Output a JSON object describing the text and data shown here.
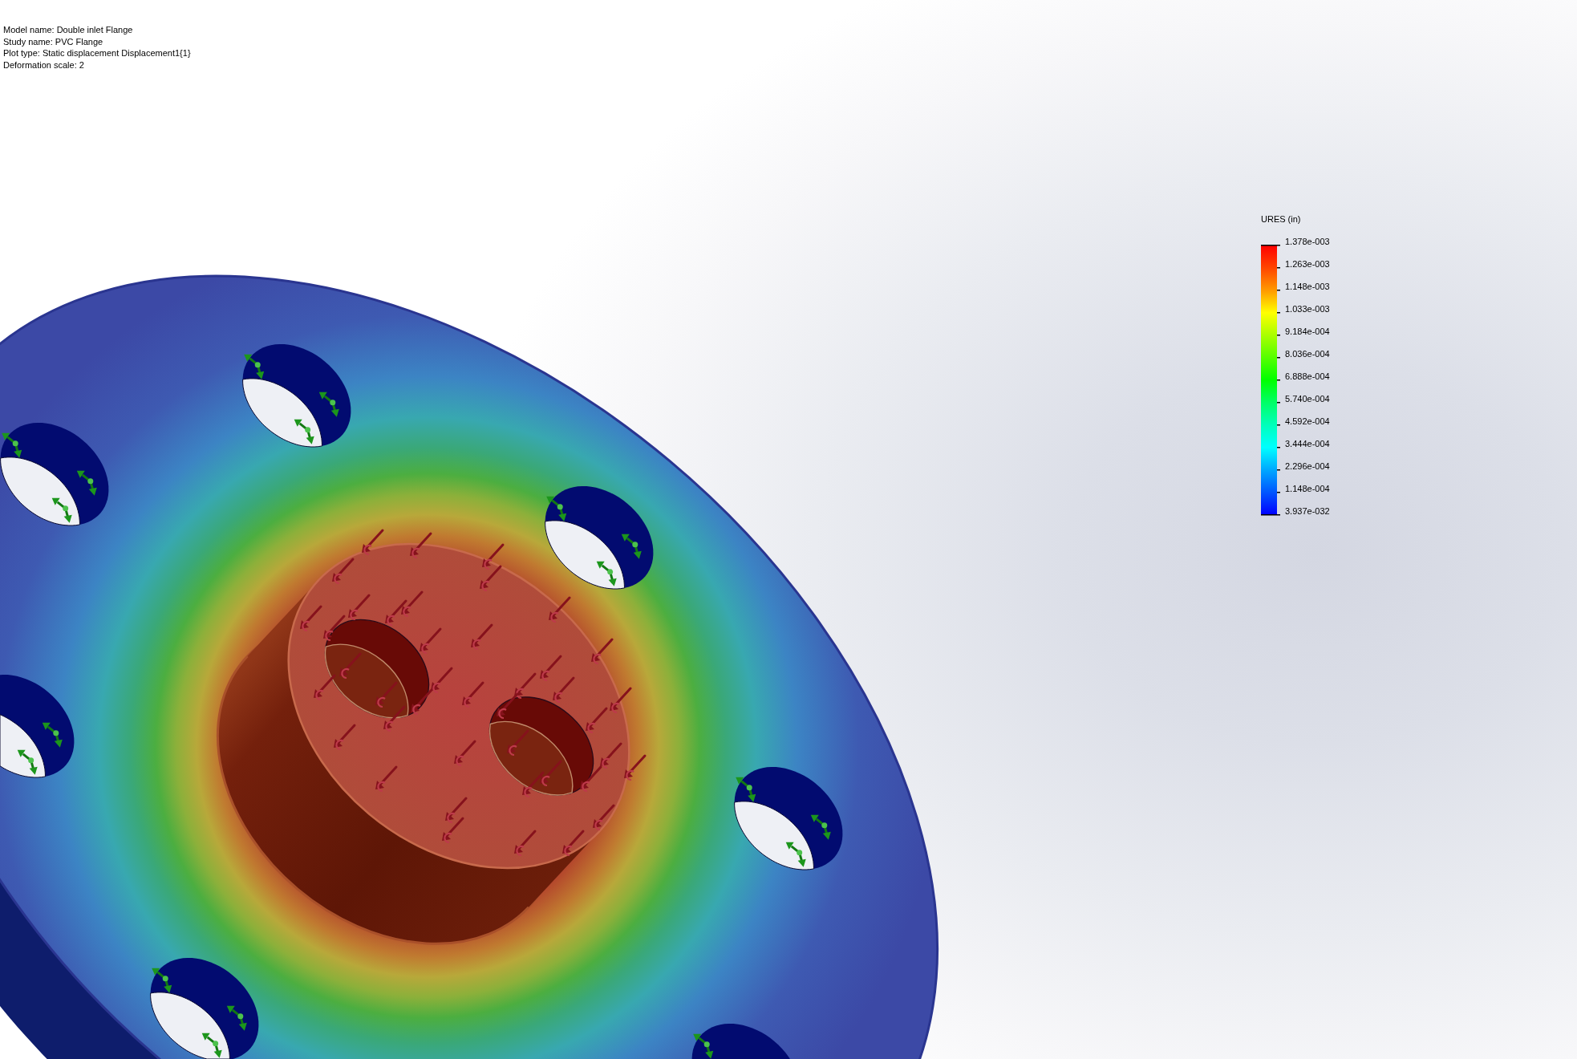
{
  "plot_info": [
    "Model name: Double inlet Flange",
    "Study name: PVC Flange",
    "Plot type: Static displacement Displacement1{1}",
    "Deformation scale: 2"
  ],
  "legend": {
    "title": "URES (in)",
    "values": [
      "1.378e-003",
      "1.263e-003",
      "1.148e-003",
      "1.033e-003",
      "9.184e-004",
      "8.036e-004",
      "6.888e-004",
      "5.740e-004",
      "4.592e-004",
      "3.444e-004",
      "2.296e-004",
      "1.148e-004",
      "3.937e-032"
    ]
  }
}
